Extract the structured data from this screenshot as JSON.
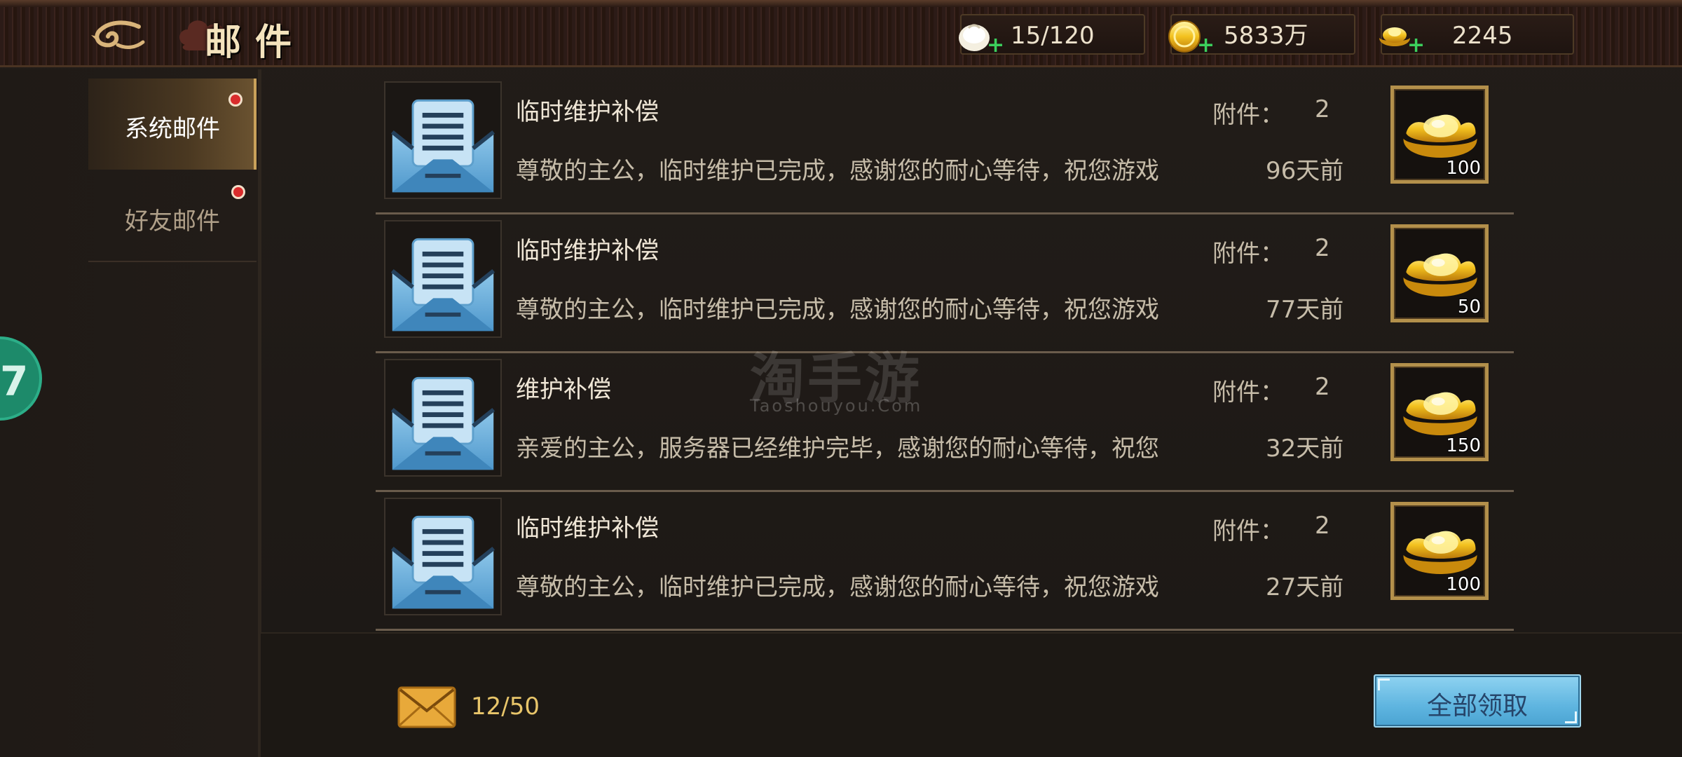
{
  "header": {
    "title": "邮件",
    "resources": [
      {
        "icon": "bun-icon",
        "value": "15/120",
        "plus": "+"
      },
      {
        "icon": "gold-coin-icon",
        "value": "5833万",
        "plus": "+"
      },
      {
        "icon": "gold-ingot-icon",
        "value": "2245",
        "plus": "+"
      }
    ]
  },
  "sidebar": {
    "tabs": [
      {
        "label": "系统邮件",
        "selected": true,
        "unread": true
      },
      {
        "label": "好友邮件",
        "selected": false,
        "unread": true
      }
    ]
  },
  "mails": [
    {
      "title": "临时维护补偿",
      "body": "尊敬的主公，临时维护已完成，感谢您的耐心等待，祝您游戏",
      "attach_label": "附件：",
      "attach_count": "2",
      "time": "96天前",
      "reward_icon": "gold-ingot-icon",
      "reward_qty": "100"
    },
    {
      "title": "临时维护补偿",
      "body": "尊敬的主公，临时维护已完成，感谢您的耐心等待，祝您游戏",
      "attach_label": "附件：",
      "attach_count": "2",
      "time": "77天前",
      "reward_icon": "gold-ingot-icon",
      "reward_qty": "50"
    },
    {
      "title": "维护补偿",
      "body": "亲爱的主公，服务器已经维护完毕，感谢您的耐心等待，祝您",
      "attach_label": "附件：",
      "attach_count": "2",
      "time": "32天前",
      "reward_icon": "gold-ingot-icon",
      "reward_qty": "150"
    },
    {
      "title": "临时维护补偿",
      "body": "尊敬的主公，临时维护已完成，感谢您的耐心等待，祝您游戏",
      "attach_label": "附件：",
      "attach_count": "2",
      "time": "27天前",
      "reward_icon": "gold-ingot-icon",
      "reward_qty": "100"
    }
  ],
  "footer": {
    "mail_count": "12/50",
    "claim_all_label": "全部领取"
  },
  "floating_button": {
    "label": "7"
  },
  "watermark": {
    "cn": "淘手游",
    "en": "Taoshouyou.Com"
  },
  "colors": {
    "accent_gold": "#c9a15a",
    "claim_button": "#5fb5e0",
    "unread_dot": "#d92c2c"
  }
}
